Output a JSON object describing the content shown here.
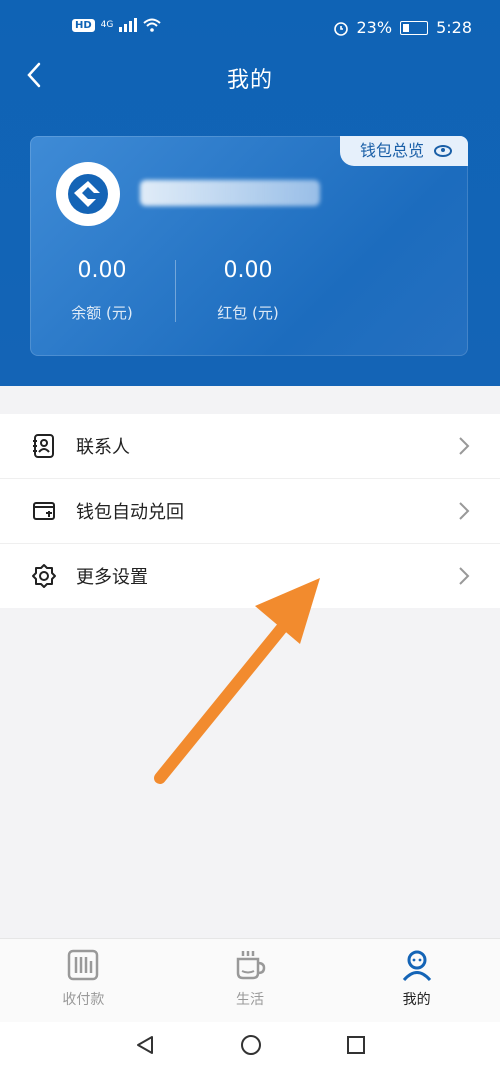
{
  "status_bar": {
    "left_badge": "HD",
    "network": "4G",
    "battery": "23%",
    "time": "5:28"
  },
  "header": {
    "title": "我的"
  },
  "wallet_card": {
    "overview_label": "钱包总览",
    "balance_value": "0.00",
    "balance_label": "余额 (元)",
    "redpacket_value": "0.00",
    "redpacket_label": "红包 (元)"
  },
  "menu": {
    "items": [
      {
        "label": "联系人",
        "icon": "contacts-icon"
      },
      {
        "label": "钱包自动兑回",
        "icon": "wallet-refund-icon"
      },
      {
        "label": "更多设置",
        "icon": "gear-icon"
      }
    ]
  },
  "tabs": [
    {
      "label": "收付款",
      "icon": "payment-icon",
      "active": false
    },
    {
      "label": "生活",
      "icon": "cup-icon",
      "active": false
    },
    {
      "label": "我的",
      "icon": "person-icon",
      "active": true
    }
  ],
  "colors": {
    "primary": "#1464b6",
    "card": "#2d7ccb",
    "accent_arrow": "#f28b2e"
  }
}
